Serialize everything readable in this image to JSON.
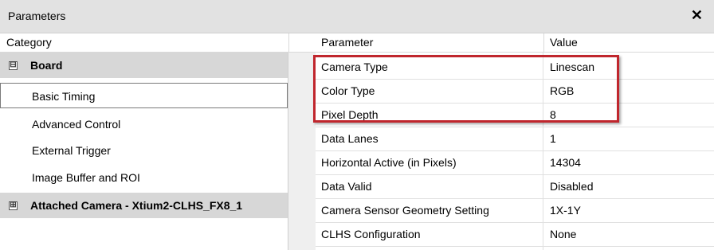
{
  "window": {
    "title": "Parameters",
    "close_glyph": "✕"
  },
  "headers": {
    "category": "Category",
    "parameter": "Parameter",
    "value": "Value"
  },
  "tree": [
    {
      "label": "Board",
      "type": "section",
      "expander": "⊟"
    },
    {
      "label": "Basic Timing",
      "type": "child",
      "selected": true
    },
    {
      "label": "Advanced Control",
      "type": "child"
    },
    {
      "label": "External Trigger",
      "type": "child"
    },
    {
      "label": "Image Buffer and ROI",
      "type": "child"
    },
    {
      "label": "Attached Camera - Xtium2-CLHS_FX8_1",
      "type": "section",
      "expander": "⊞"
    }
  ],
  "rows": [
    {
      "parameter": "Camera Type",
      "value": "Linescan"
    },
    {
      "parameter": "Color Type",
      "value": "RGB"
    },
    {
      "parameter": "Pixel Depth",
      "value": "8"
    },
    {
      "parameter": "Data Lanes",
      "value": "1"
    },
    {
      "parameter": "Horizontal Active (in Pixels)",
      "value": "14304"
    },
    {
      "parameter": "Data Valid",
      "value": "Disabled"
    },
    {
      "parameter": "Camera Sensor Geometry Setting",
      "value": "1X-1Y"
    },
    {
      "parameter": "CLHS Configuration",
      "value": "None"
    }
  ],
  "colors": {
    "highlight": "#c0262d",
    "section_bg": "#d7d7d7",
    "titlebar_bg": "#e2e2e2"
  }
}
